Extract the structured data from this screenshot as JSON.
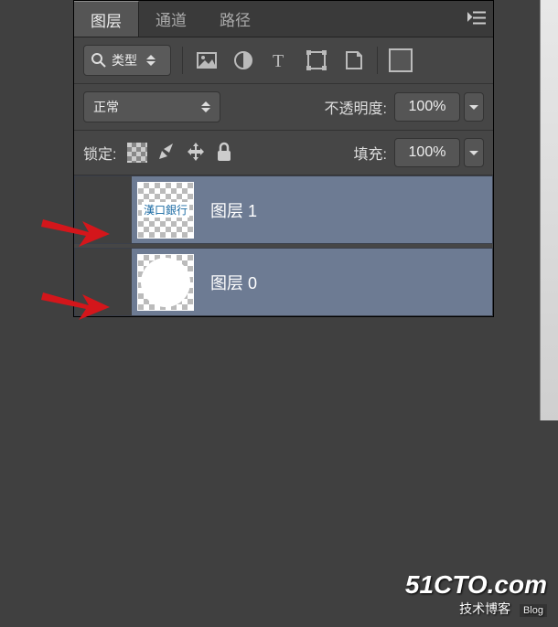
{
  "tabs": {
    "layers": "图层",
    "channels": "通道",
    "paths": "路径"
  },
  "filter": {
    "label": "类型"
  },
  "blend": {
    "mode": "正常",
    "opacity_label": "不透明度:",
    "opacity_value": "100%"
  },
  "lock": {
    "label": "锁定:",
    "fill_label": "填充:",
    "fill_value": "100%"
  },
  "layers": [
    {
      "name": "图层 1",
      "thumb_text": "漢口銀行"
    },
    {
      "name": "图层 0",
      "thumb_text": ""
    }
  ],
  "watermark": {
    "site": "51CTO.com",
    "sub": "技术博客",
    "blog": "Blog"
  }
}
